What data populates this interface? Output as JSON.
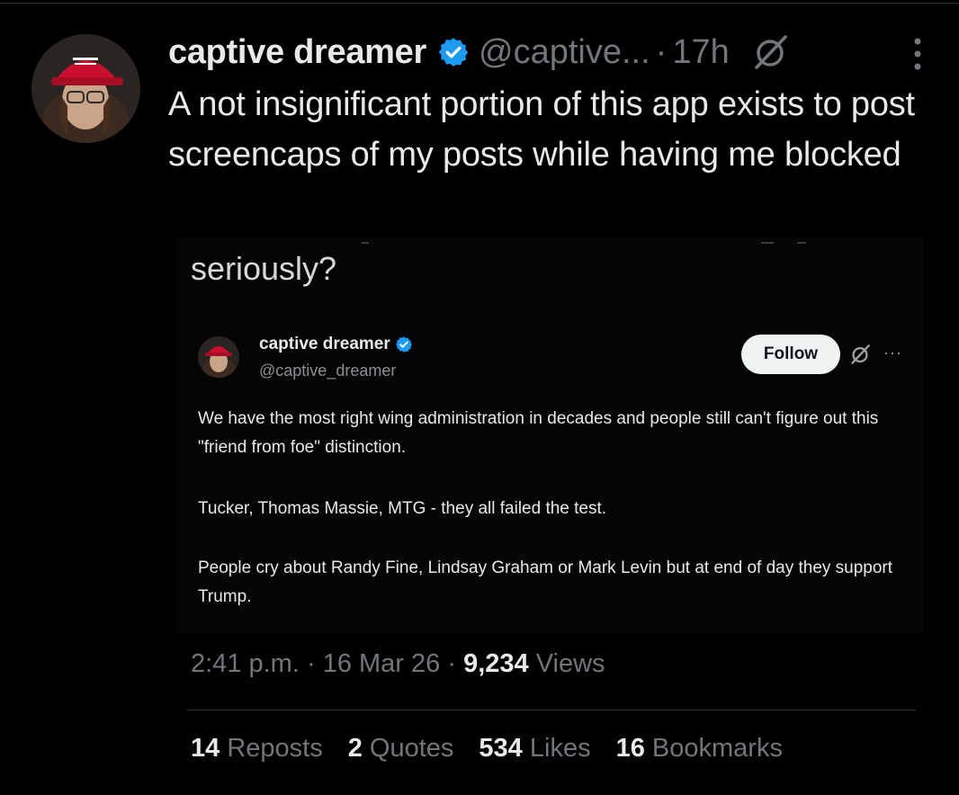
{
  "post": {
    "display_name": "captive dreamer",
    "handle": "@captive...",
    "separator": "·",
    "time": "17h",
    "text": "A not insignificant portion of this app exists to post screencaps of my posts while having me blocked"
  },
  "screenshot": {
    "prefix_text": "seriously?",
    "inner_post": {
      "display_name": "captive dreamer",
      "handle": "@captive_dreamer",
      "follow_label": "Follow",
      "more_label": "···",
      "paragraphs": [
        "We have the most right wing administration in decades and people still can't figure out this \"friend from foe\" distinction.",
        "Tucker, Thomas Massie, MTG - they all failed the test.",
        "People cry about Randy Fine, Lindsay Graham or Mark Levin but at end of day they support Trump."
      ]
    }
  },
  "meta": {
    "time": "2:41 p.m.",
    "separator": "·",
    "date": "16 Mar 26",
    "views_count": "9,234",
    "views_label": "Views"
  },
  "stats": {
    "reposts_count": "14",
    "reposts_label": "Reposts",
    "quotes_count": "2",
    "quotes_label": "Quotes",
    "likes_count": "534",
    "likes_label": "Likes",
    "bookmarks_count": "16",
    "bookmarks_label": "Bookmarks"
  },
  "colors": {
    "background": "#000000",
    "primary_text": "#e7e9ea",
    "secondary_text": "#71767b",
    "verified_badge": "#1d9bf0",
    "hat_red": "#c8102e"
  },
  "icons": [
    "verified-badge-icon",
    "grok-icon",
    "more-options-icon"
  ]
}
